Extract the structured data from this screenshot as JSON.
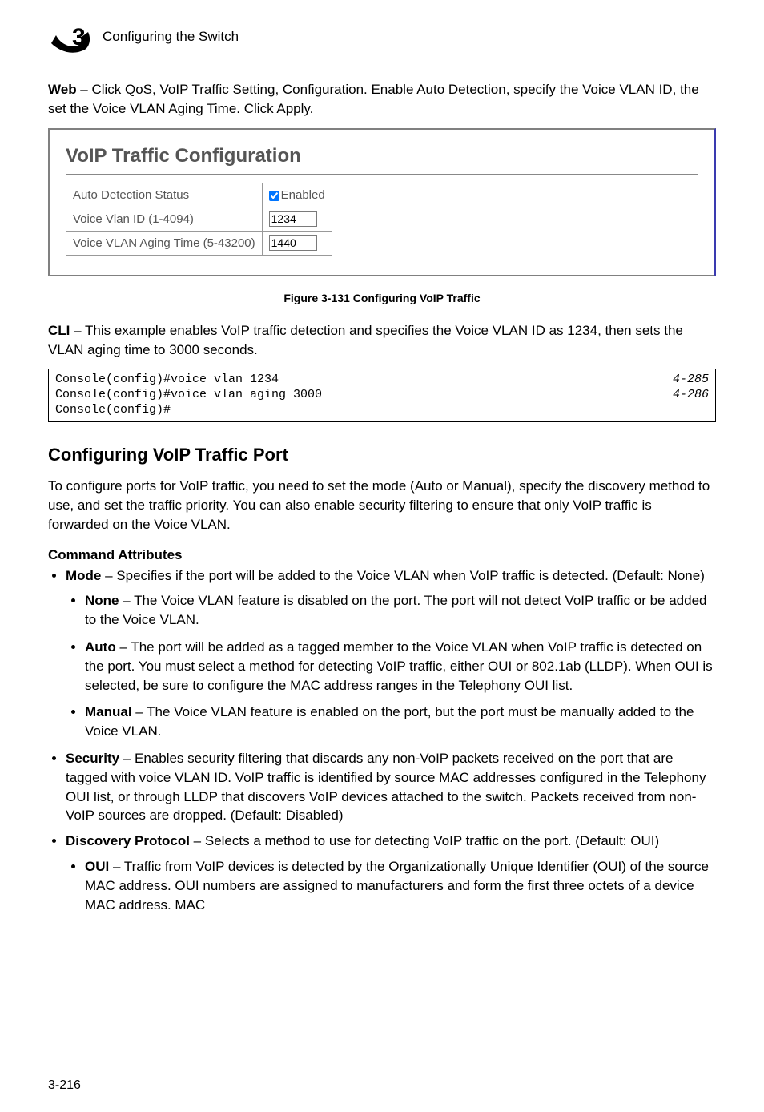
{
  "header": {
    "chapter_number": "3",
    "chapter_title": "Configuring the Switch"
  },
  "intro_web": {
    "bold": "Web",
    "text": " – Click QoS, VoIP Traffic Setting, Configuration. Enable Auto Detection, specify the Voice VLAN ID, the set the Voice VLAN Aging Time. Click Apply."
  },
  "panel": {
    "title": "VoIP Traffic Configuration",
    "rows": {
      "auto_detection_label": "Auto Detection Status",
      "auto_detection_enabled_label": "Enabled",
      "voice_vlan_id_label": "Voice Vlan ID (1-4094)",
      "voice_vlan_id_value": "1234",
      "aging_time_label": "Voice VLAN Aging Time (5-43200)",
      "aging_time_value": "1440"
    }
  },
  "figure_caption": "Figure 3-131  Configuring VoIP Traffic",
  "intro_cli": {
    "bold": "CLI",
    "text": " – This example enables VoIP traffic detection and specifies the Voice VLAN ID as 1234, then sets the VLAN aging time to 3000 seconds."
  },
  "code": {
    "line1_cmd": "Console(config)#voice vlan 1234",
    "line1_ref": "4-285",
    "line2_cmd": "Console(config)#voice vlan aging 3000",
    "line2_ref": "4-286",
    "line3_cmd": "Console(config)#"
  },
  "section_heading": "Configuring VoIP Traffic Port",
  "section_intro": "To configure ports for VoIP traffic, you need to set the mode (Auto or Manual), specify the discovery method to use, and set the traffic priority. You can also enable security filtering to ensure that only VoIP traffic is forwarded on the Voice VLAN.",
  "cmd_attr_heading": "Command Attributes",
  "bullets": {
    "mode": {
      "bold": "Mode",
      "text": " – Specifies if the port will be added to the Voice VLAN when VoIP traffic is detected. (Default: None)",
      "sub": {
        "none": {
          "bold": "None",
          "text": " – The Voice VLAN feature is disabled on the port. The port will not detect VoIP traffic or be added to the Voice VLAN."
        },
        "auto": {
          "bold": "Auto",
          "text": " – The port will be added as a tagged member to the Voice VLAN when VoIP traffic is detected on the port. You must select a method for detecting VoIP traffic, either OUI or 802.1ab (LLDP). When OUI is selected, be sure to configure the MAC address ranges in the Telephony OUI list."
        },
        "manual": {
          "bold": "Manual",
          "text": " – The Voice VLAN feature is enabled on the port, but the port must be manually added to the Voice VLAN."
        }
      }
    },
    "security": {
      "bold": "Security",
      "text": " – Enables security filtering that discards any non-VoIP packets received on the port that are tagged with voice VLAN ID. VoIP traffic is identified by source MAC addresses configured in the Telephony OUI list, or through LLDP that discovers VoIP devices attached to the switch. Packets received from non-VoIP sources are dropped. (Default: Disabled)"
    },
    "discovery": {
      "bold": "Discovery Protocol",
      "text": " – Selects a method to use for detecting VoIP traffic on the port. (Default: OUI)",
      "sub": {
        "oui": {
          "bold": "OUI",
          "text": " – Traffic from VoIP devices is detected by the Organizationally Unique Identifier (OUI) of the source MAC address. OUI numbers are assigned to manufacturers and form the first three octets of a device MAC address. MAC"
        }
      }
    }
  },
  "page_number": "3-216"
}
